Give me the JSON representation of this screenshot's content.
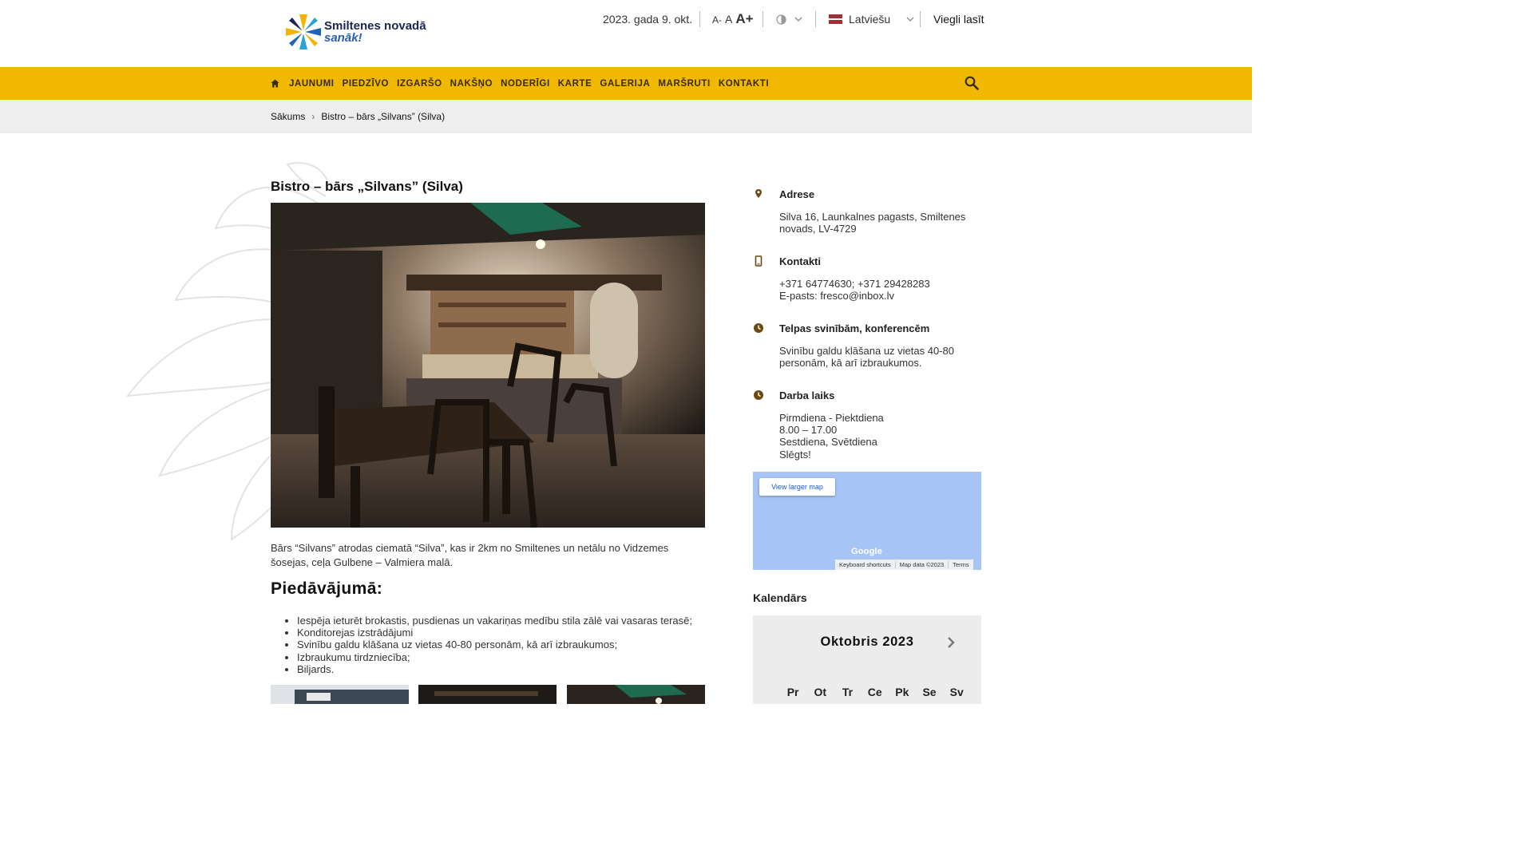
{
  "header": {
    "logo": {
      "line1": "Smiltenes novadā",
      "line2": "sanāk!"
    },
    "date": "2023. gada 9. okt.",
    "font_sizes": {
      "small": "A-",
      "normal": "A",
      "large": "A+"
    },
    "language": "Latviešu",
    "easy_read": "Viegli lasīt"
  },
  "nav": {
    "items": [
      "JAUNUMI",
      "PIEDZĪVO",
      "IZGARŠO",
      "NAKŠŅO",
      "NODERĪGI",
      "KARTE",
      "GALERIJA",
      "MARŠRUTI",
      "KONTAKTI"
    ]
  },
  "breadcrumb": {
    "home": "Sākums",
    "sep": "›",
    "current": "Bistro – bārs „Silvans” (Silva)"
  },
  "main": {
    "title": "Bistro – bārs „Silvans” (Silva)",
    "intro": "Bārs “Silvans” atrodas ciematā “Silva”, kas ir 2km no Smiltenes un netālu no Vidzemes šosejas, ceļa Gulbene – Valmiera malā.",
    "offer_title": "Piedāvājumā:",
    "offers": [
      "Iespēja ieturēt brokastis, pusdienas un vakariņas medību stila zālē vai vasaras terasē;",
      "Konditorejas izstrādājumi",
      "Svinību galdu klāšana uz vietas 40-80 personām, kā arī izbraukumos;",
      "Izbraukumu tirdzniecība;",
      "Biljards."
    ]
  },
  "sidebar": {
    "address": {
      "label": "Adrese",
      "lines": [
        "Silva 16, Launkalnes pagasts, Smiltenes",
        "novads, LV-4729"
      ]
    },
    "contacts": {
      "label": "Kontakti",
      "lines": [
        "+371 64774630; +371 29428283",
        "E-pasts: fresco@inbox.lv"
      ]
    },
    "venues": {
      "label": "Telpas svinībām, konferencēm",
      "lines": [
        "Svinību galdu klāšana uz vietas 40-80",
        "personām, kā arī izbraukumos."
      ]
    },
    "hours": {
      "label": "Darba laiks",
      "lines": [
        "Pirmdiena - Piektdiena",
        "8.00 – 17.00",
        "Sestdiena, Svētdiena",
        "Slēgts!"
      ]
    },
    "map": {
      "larger": "View larger map",
      "google": "Google",
      "footer": [
        "Keyboard shortcuts",
        "Map data ©2023",
        "Terms"
      ]
    }
  },
  "calendar": {
    "title": "Kalendārs",
    "month": "Oktobris 2023",
    "weekdays": [
      "Pr",
      "Ot",
      "Tr",
      "Ce",
      "Pk",
      "Se",
      "Sv"
    ]
  },
  "colors": {
    "nav_bg": "#f0b800",
    "icon": "#6b4a12",
    "crumb_bg": "#eeeeee",
    "map_bg": "#a6c4f5"
  }
}
